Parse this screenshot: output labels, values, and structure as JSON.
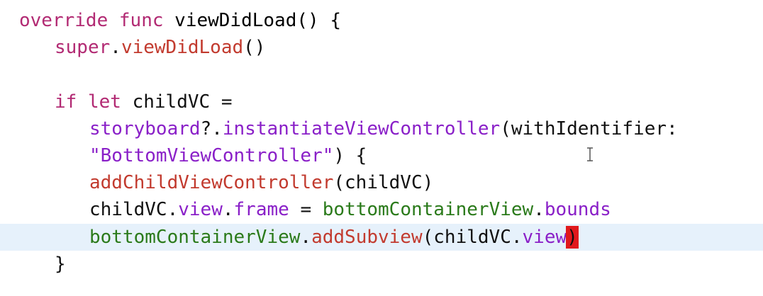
{
  "editor": {
    "lines": [
      {
        "tokens": [
          {
            "text": "override",
            "kind": "kw"
          },
          {
            "text": " ",
            "kind": "plain"
          },
          {
            "text": "func",
            "kind": "kw"
          },
          {
            "text": " viewDidLoad() {",
            "kind": "fn"
          }
        ]
      },
      {
        "tokens": [
          {
            "text": "super",
            "kind": "kw"
          },
          {
            "text": ".",
            "kind": "plain"
          },
          {
            "text": "viewDidLoad",
            "kind": "call"
          },
          {
            "text": "()",
            "kind": "plain"
          }
        ]
      },
      {
        "tokens": []
      },
      {
        "tokens": [
          {
            "text": "if",
            "kind": "kw"
          },
          {
            "text": " ",
            "kind": "plain"
          },
          {
            "text": "let",
            "kind": "kw"
          },
          {
            "text": " childVC =",
            "kind": "plain"
          }
        ]
      },
      {
        "tokens": [
          {
            "text": "storyboard",
            "kind": "str"
          },
          {
            "text": "?.",
            "kind": "plain"
          },
          {
            "text": "instantiateViewController",
            "kind": "str"
          },
          {
            "text": "(withIdentifier:",
            "kind": "plain"
          }
        ]
      },
      {
        "tokens": [
          {
            "text": "\"BottomViewController\"",
            "kind": "str"
          },
          {
            "text": ") {",
            "kind": "plain"
          }
        ]
      },
      {
        "tokens": [
          {
            "text": "addChildViewController",
            "kind": "call"
          },
          {
            "text": "(childVC)",
            "kind": "plain"
          }
        ]
      },
      {
        "tokens": [
          {
            "text": "childVC.",
            "kind": "plain"
          },
          {
            "text": "view",
            "kind": "str"
          },
          {
            "text": ".",
            "kind": "plain"
          },
          {
            "text": "frame",
            "kind": "str"
          },
          {
            "text": " = ",
            "kind": "plain"
          },
          {
            "text": "bottomContainerView",
            "kind": "var"
          },
          {
            "text": ".",
            "kind": "plain"
          },
          {
            "text": "bounds",
            "kind": "str"
          }
        ]
      },
      {
        "current": true,
        "tokens": [
          {
            "text": "bottomContainerView",
            "kind": "var"
          },
          {
            "text": ".",
            "kind": "plain"
          },
          {
            "text": "addSubview",
            "kind": "call"
          },
          {
            "text": "(childVC.",
            "kind": "plain"
          },
          {
            "text": "view",
            "kind": "str"
          },
          {
            "text": ")",
            "kind": "caret-bracket"
          }
        ]
      },
      {
        "tokens": [
          {
            "text": "}",
            "kind": "plain"
          }
        ]
      }
    ]
  },
  "colors": {
    "keyword": "#b22a73",
    "method_call": "#c23a2e",
    "variable": "#2a7a1a",
    "property_and_string": "#8a20c8",
    "current_line": "#e6f1fb",
    "bracket_match": "#e0191c"
  },
  "icons": {
    "cursor": "text-ibeam-icon"
  }
}
